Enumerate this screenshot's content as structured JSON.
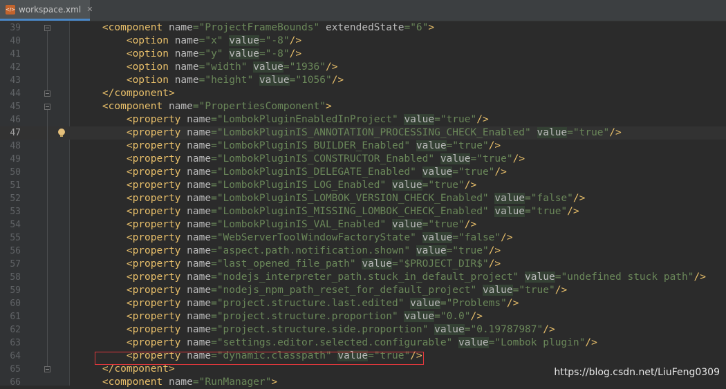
{
  "tab": {
    "icon": "xml-file-icon",
    "title": "workspace.xml",
    "close": "✕"
  },
  "current_line": 47,
  "lines": [
    {
      "num": "39",
      "code": "    <component name=\"ProjectFrameBounds\" extendedState=\"6\">"
    },
    {
      "num": "40",
      "code": "        <option name=\"x\" value=\"-8\"/>"
    },
    {
      "num": "41",
      "code": "        <option name=\"y\" value=\"-8\"/>"
    },
    {
      "num": "42",
      "code": "        <option name=\"width\" value=\"1936\"/>"
    },
    {
      "num": "43",
      "code": "        <option name=\"height\" value=\"1056\"/>"
    },
    {
      "num": "44",
      "code": "    </component>"
    },
    {
      "num": "45",
      "code": "    <component name=\"PropertiesComponent\">"
    },
    {
      "num": "46",
      "code": "        <property name=\"LombokPluginEnabledInProject\" value=\"true\"/>"
    },
    {
      "num": "47",
      "code": "        <property name=\"LombokPluginIS_ANNOTATION_PROCESSING_CHECK_Enabled\" value=\"true\"/>"
    },
    {
      "num": "48",
      "code": "        <property name=\"LombokPluginIS_BUILDER_Enabled\" value=\"true\"/>"
    },
    {
      "num": "49",
      "code": "        <property name=\"LombokPluginIS_CONSTRUCTOR_Enabled\" value=\"true\"/>"
    },
    {
      "num": "50",
      "code": "        <property name=\"LombokPluginIS_DELEGATE_Enabled\" value=\"true\"/>"
    },
    {
      "num": "51",
      "code": "        <property name=\"LombokPluginIS_LOG_Enabled\" value=\"true\"/>"
    },
    {
      "num": "52",
      "code": "        <property name=\"LombokPluginIS_LOMBOK_VERSION_CHECK_Enabled\" value=\"false\"/>"
    },
    {
      "num": "53",
      "code": "        <property name=\"LombokPluginIS_MISSING_LOMBOK_CHECK_Enabled\" value=\"true\"/>"
    },
    {
      "num": "54",
      "code": "        <property name=\"LombokPluginIS_VAL_Enabled\" value=\"true\"/>"
    },
    {
      "num": "55",
      "code": "        <property name=\"WebServerToolWindowFactoryState\" value=\"false\"/>"
    },
    {
      "num": "56",
      "code": "        <property name=\"aspect.path.notification.shown\" value=\"true\"/>"
    },
    {
      "num": "57",
      "code": "        <property name=\"last_opened_file_path\" value=\"$PROJECT_DIR$\"/>"
    },
    {
      "num": "58",
      "code": "        <property name=\"nodejs_interpreter_path.stuck_in_default_project\" value=\"undefined stuck path\"/>"
    },
    {
      "num": "59",
      "code": "        <property name=\"nodejs_npm_path_reset_for_default_project\" value=\"true\"/>"
    },
    {
      "num": "60",
      "code": "        <property name=\"project.structure.last.edited\" value=\"Problems\"/>"
    },
    {
      "num": "61",
      "code": "        <property name=\"project.structure.proportion\" value=\"0.0\"/>"
    },
    {
      "num": "62",
      "code": "        <property name=\"project.structure.side.proportion\" value=\"0.19787987\"/>"
    },
    {
      "num": "63",
      "code": "        <property name=\"settings.editor.selected.configurable\" value=\"Lombok plugin\"/>"
    },
    {
      "num": "64",
      "code": "        <property name=\"dynamic.classpath\" value=\"true\"/>"
    },
    {
      "num": "65",
      "code": "    </component>"
    },
    {
      "num": "66",
      "code": "    <component name=\"RunManager\">"
    }
  ],
  "watermark": "https://blog.csdn.net/LiuFeng0309",
  "colors": {
    "background": "#2b2b2b",
    "tag": "#e8bf6a",
    "attribute": "#bababa",
    "string": "#6a8759",
    "highlight_box": "#e0383c"
  }
}
